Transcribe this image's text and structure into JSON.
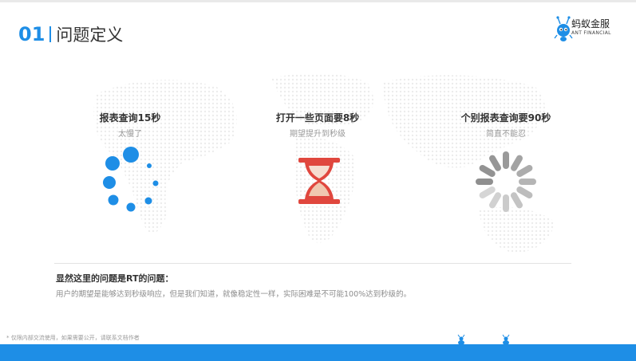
{
  "header": {
    "number": "01",
    "title": "问题定义"
  },
  "logo": {
    "name_cn": "蚂蚁金服",
    "name_en": "ANT FINANCIAL",
    "icon": "ant-logo-icon"
  },
  "cards": [
    {
      "title": "报表查询15秒",
      "subtitle": "太慢了",
      "icon": "loading-dots-icon"
    },
    {
      "title": "打开一些页面要8秒",
      "subtitle": "期望提升到秒级",
      "icon": "hourglass-icon"
    },
    {
      "title": "个别报表查询要90秒",
      "subtitle": "简直不能忍",
      "icon": "spinner-icon"
    }
  ],
  "conclusion": {
    "title": "显然这里的问题是RT的问题：",
    "text": "用户的期望是能够达到秒级响应，但是我们知道，就像稳定性一样，实际困难是不可能100%达到秒级的。"
  },
  "footnote": "* 仅限内部交流使用，如果需要公开，请联系文档作者",
  "colors": {
    "accent": "#1e8ee6",
    "hourglass": "#e0473e",
    "sand": "#f0c8b0",
    "spinner": "#a6a6a6"
  }
}
